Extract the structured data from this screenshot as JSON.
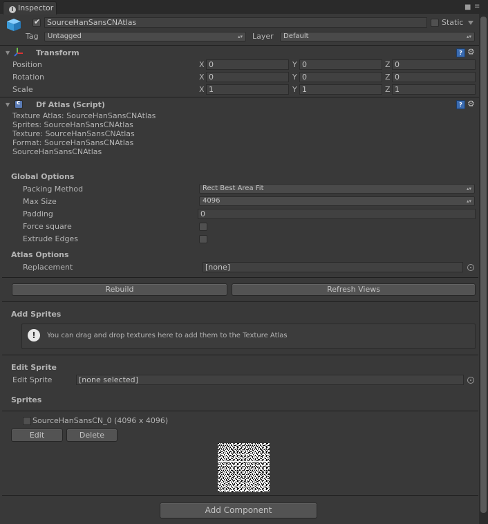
{
  "window": {
    "tab_label": "Inspector"
  },
  "gameobject": {
    "name": "SourceHanSansCNAtlas",
    "static_label": "Static",
    "tag_label": "Tag",
    "tag_value": "Untagged",
    "layer_label": "Layer",
    "layer_value": "Default"
  },
  "transform": {
    "title": "Transform",
    "rows": [
      {
        "label": "Position",
        "x": "0",
        "y": "0",
        "z": "0"
      },
      {
        "label": "Rotation",
        "x": "0",
        "y": "0",
        "z": "0"
      },
      {
        "label": "Scale",
        "x": "1",
        "y": "1",
        "z": "1"
      }
    ],
    "axis_x": "X",
    "axis_y": "Y",
    "axis_z": "Z"
  },
  "dfatlas": {
    "title": "Df Atlas (Script)",
    "info": [
      "Texture Atlas: SourceHanSansCNAtlas",
      "Sprites: SourceHanSansCNAtlas",
      "Texture: SourceHanSansCNAtlas",
      "Format: SourceHanSansCNAtlas",
      "SourceHanSansCNAtlas"
    ],
    "global_options": "Global Options",
    "packing_method_label": "Packing Method",
    "packing_method_value": "Rect Best Area Fit",
    "max_size_label": "Max Size",
    "max_size_value": "4096",
    "padding_label": "Padding",
    "padding_value": "0",
    "force_square_label": "Force square",
    "extrude_edges_label": "Extrude Edges",
    "atlas_options": "Atlas Options",
    "replacement_label": "Replacement",
    "replacement_value": "[none]",
    "rebuild_label": "Rebuild",
    "refresh_label": "Refresh Views",
    "add_sprites": "Add Sprites",
    "drop_hint": "You can drag and drop textures here to add them to the Texture Atlas",
    "edit_sprite_header": "Edit Sprite",
    "edit_sprite_label": "Edit Sprite",
    "edit_sprite_value": "[none selected]",
    "sprites_header": "Sprites",
    "sprite_item": "SourceHanSansCN_0 (4096 x 4096)",
    "edit_button": "Edit",
    "delete_button": "Delete"
  },
  "add_component_label": "Add Component",
  "colors": {
    "background": "#393939",
    "accent_help": "#3a6bb0",
    "field": "#414141"
  }
}
